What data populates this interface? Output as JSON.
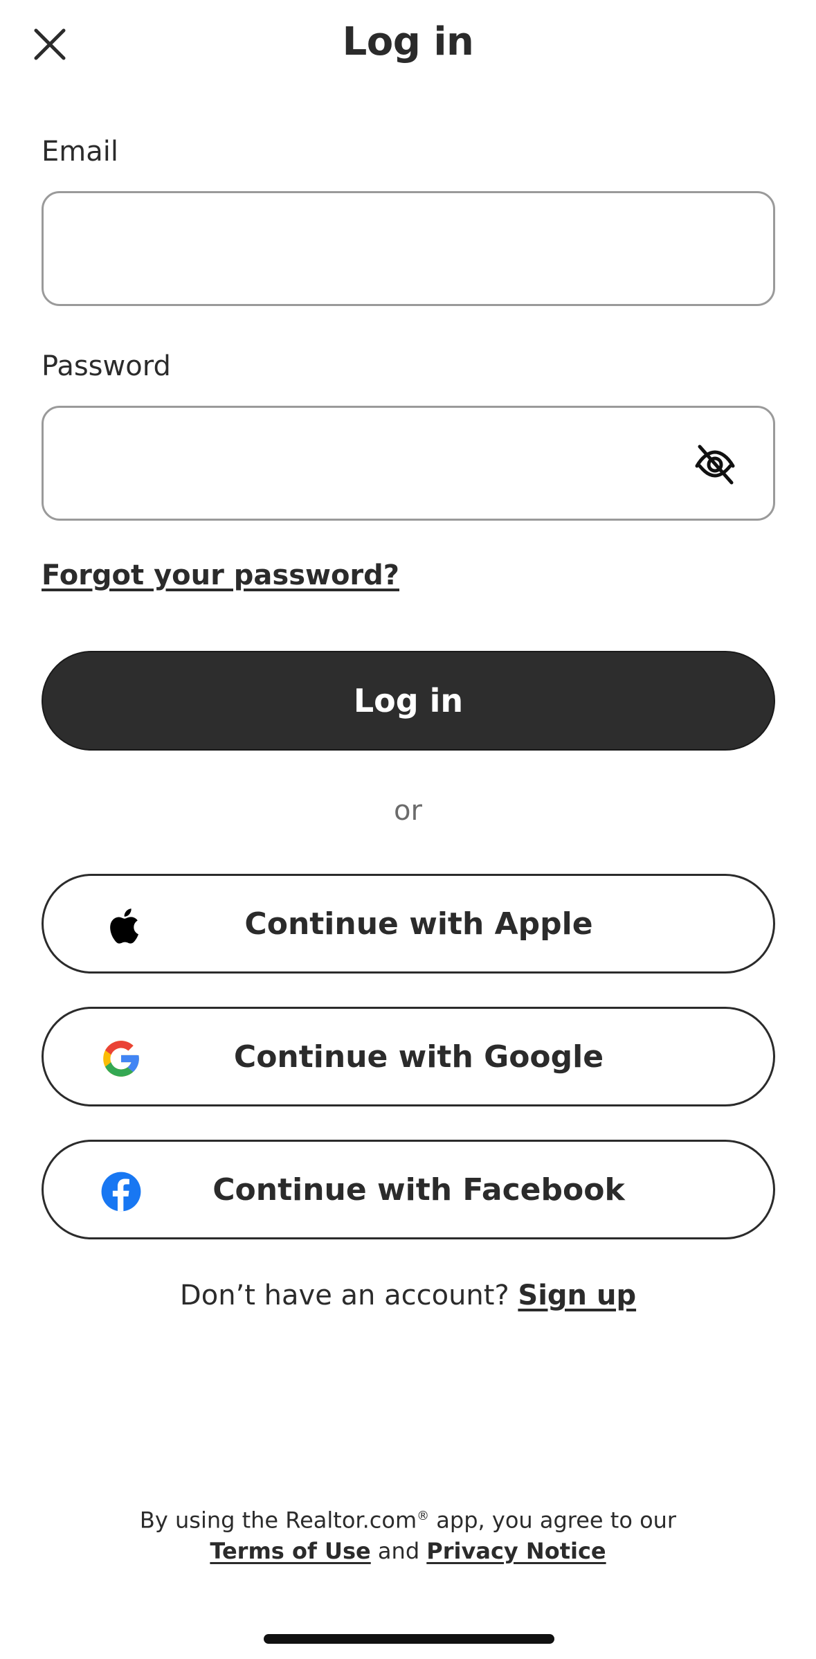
{
  "header": {
    "title": "Log in",
    "close_icon": "close-icon"
  },
  "form": {
    "email_label": "Email",
    "email_value": "",
    "password_label": "Password",
    "password_value": "",
    "password_toggle_icon": "eye-off-icon",
    "forgot_link": "Forgot your password?",
    "submit_label": "Log in"
  },
  "divider": {
    "or_text": "or"
  },
  "social": {
    "apple_label": "Continue with Apple",
    "google_label": "Continue with Google",
    "facebook_label": "Continue with Facebook",
    "apple_icon": "apple-icon",
    "google_icon": "google-icon",
    "facebook_icon": "facebook-icon"
  },
  "signup": {
    "prompt": "Don’t have an account?",
    "link": "Sign up"
  },
  "legal": {
    "prefix": "By using the Realtor.com",
    "registered": "®",
    "suffix": " app, you agree to our",
    "terms": "Terms of Use",
    "and": "and",
    "privacy": "Privacy Notice"
  },
  "colors": {
    "primary_button": "#2d2d2d",
    "facebook_blue": "#1877f2",
    "google_blue": "#4285f4",
    "google_red": "#ea4335",
    "google_yellow": "#fbbc05",
    "google_green": "#34a853"
  }
}
